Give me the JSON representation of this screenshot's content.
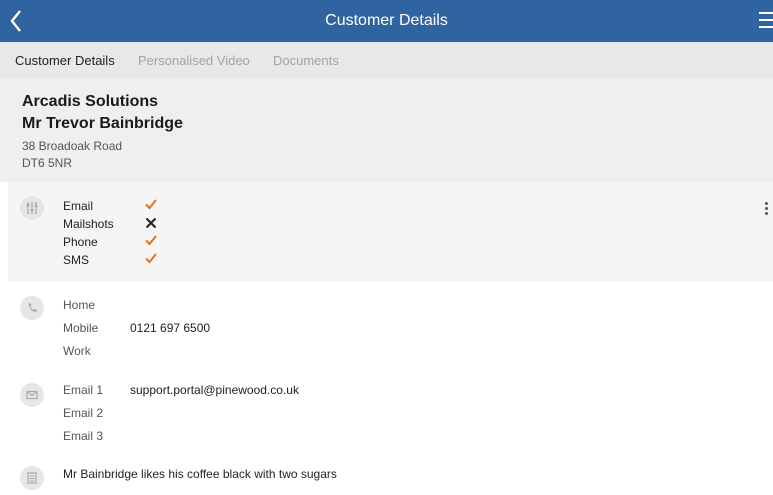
{
  "titlebar": {
    "title": "Customer Details"
  },
  "tabs": [
    {
      "label": "Customer Details",
      "active": true
    },
    {
      "label": "Personalised Video",
      "active": false
    },
    {
      "label": "Documents",
      "active": false
    }
  ],
  "customer": {
    "company": "Arcadis Solutions",
    "name": "Mr Trevor Bainbridge",
    "address_line1": "38 Broadoak Road",
    "postcode": "DT6 5NR"
  },
  "preferences": {
    "icon": "sliders-icon",
    "items": [
      {
        "label": "Email",
        "status": "check"
      },
      {
        "label": "Mailshots",
        "status": "cross"
      },
      {
        "label": "Phone",
        "status": "check"
      },
      {
        "label": "SMS",
        "status": "check"
      }
    ]
  },
  "phones": {
    "icon": "phone-icon",
    "items": [
      {
        "label": "Home",
        "value": ""
      },
      {
        "label": "Mobile",
        "value": "0121 697 6500"
      },
      {
        "label": "Work",
        "value": ""
      }
    ]
  },
  "emails": {
    "icon": "envelope-icon",
    "items": [
      {
        "label": "Email 1",
        "value": "support.portal@pinewood.co.uk"
      },
      {
        "label": "Email 2",
        "value": ""
      },
      {
        "label": "Email 3",
        "value": ""
      }
    ]
  },
  "notes": {
    "icon": "notepad-icon",
    "text": "Mr Bainbridge likes his coffee black with two sugars"
  },
  "colors": {
    "titlebar": "#2f64a0",
    "check": "#e8701a",
    "cross": "#222222"
  }
}
